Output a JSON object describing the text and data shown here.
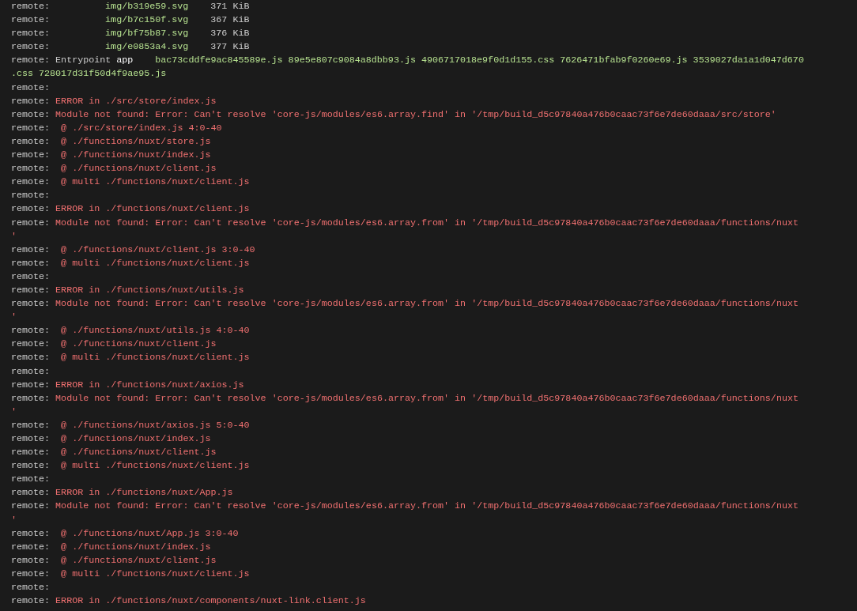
{
  "terminal": {
    "lines": [
      {
        "kind": "asset",
        "prefix": "remote:",
        "file": "img/b319e59.svg",
        "size": "371 KiB"
      },
      {
        "kind": "asset",
        "prefix": "remote:",
        "file": "img/b7c150f.svg",
        "size": "367 KiB"
      },
      {
        "kind": "asset",
        "prefix": "remote:",
        "file": "img/bf75b87.svg",
        "size": "376 KiB"
      },
      {
        "kind": "asset",
        "prefix": "remote:",
        "file": "img/e0853a4.svg",
        "size": "377 KiB"
      },
      {
        "kind": "entrypoint",
        "prefix": "remote:",
        "label": "Entrypoint",
        "name": "app",
        "files": "bac73cddfe9ac845589e.js 89e5e807c9084a8dbb93.js 4906717018e9f0d1d155.css 7626471bfab9f0260e69.js 3539027da1a1d047d670"
      },
      {
        "kind": "continuation_files",
        "text": ".css 728017d31f50d4f9ae95.js"
      },
      {
        "kind": "blank",
        "prefix": "remote:"
      },
      {
        "kind": "error",
        "prefix": "remote:",
        "text": "ERROR in ./src/store/index.js"
      },
      {
        "kind": "error",
        "prefix": "remote:",
        "text": "Module not found: Error: Can't resolve 'core-js/modules/es6.array.find' in '/tmp/build_d5c97840a476b0caac73f6e7de60daaa/src/store'"
      },
      {
        "kind": "error",
        "prefix": "remote:",
        "text": " @ ./src/store/index.js 4:0-40"
      },
      {
        "kind": "error",
        "prefix": "remote:",
        "text": " @ ./functions/nuxt/store.js"
      },
      {
        "kind": "error",
        "prefix": "remote:",
        "text": " @ ./functions/nuxt/index.js"
      },
      {
        "kind": "error",
        "prefix": "remote:",
        "text": " @ ./functions/nuxt/client.js"
      },
      {
        "kind": "error",
        "prefix": "remote:",
        "text": " @ multi ./functions/nuxt/client.js"
      },
      {
        "kind": "blank",
        "prefix": "remote:"
      },
      {
        "kind": "error",
        "prefix": "remote:",
        "text": "ERROR in ./functions/nuxt/client.js"
      },
      {
        "kind": "error",
        "prefix": "remote:",
        "text": "Module not found: Error: Can't resolve 'core-js/modules/es6.array.from' in '/tmp/build_d5c97840a476b0caac73f6e7de60daaa/functions/nuxt"
      },
      {
        "kind": "continuation_error",
        "text": "'"
      },
      {
        "kind": "error",
        "prefix": "remote:",
        "text": " @ ./functions/nuxt/client.js 3:0-40"
      },
      {
        "kind": "error",
        "prefix": "remote:",
        "text": " @ multi ./functions/nuxt/client.js"
      },
      {
        "kind": "blank",
        "prefix": "remote:"
      },
      {
        "kind": "error",
        "prefix": "remote:",
        "text": "ERROR in ./functions/nuxt/utils.js"
      },
      {
        "kind": "error",
        "prefix": "remote:",
        "text": "Module not found: Error: Can't resolve 'core-js/modules/es6.array.from' in '/tmp/build_d5c97840a476b0caac73f6e7de60daaa/functions/nuxt"
      },
      {
        "kind": "continuation_error",
        "text": "'"
      },
      {
        "kind": "error",
        "prefix": "remote:",
        "text": " @ ./functions/nuxt/utils.js 4:0-40"
      },
      {
        "kind": "error",
        "prefix": "remote:",
        "text": " @ ./functions/nuxt/client.js"
      },
      {
        "kind": "error",
        "prefix": "remote:",
        "text": " @ multi ./functions/nuxt/client.js"
      },
      {
        "kind": "blank",
        "prefix": "remote:"
      },
      {
        "kind": "error",
        "prefix": "remote:",
        "text": "ERROR in ./functions/nuxt/axios.js"
      },
      {
        "kind": "error",
        "prefix": "remote:",
        "text": "Module not found: Error: Can't resolve 'core-js/modules/es6.array.from' in '/tmp/build_d5c97840a476b0caac73f6e7de60daaa/functions/nuxt"
      },
      {
        "kind": "continuation_error",
        "text": "'"
      },
      {
        "kind": "error",
        "prefix": "remote:",
        "text": " @ ./functions/nuxt/axios.js 5:0-40"
      },
      {
        "kind": "error",
        "prefix": "remote:",
        "text": " @ ./functions/nuxt/index.js"
      },
      {
        "kind": "error",
        "prefix": "remote:",
        "text": " @ ./functions/nuxt/client.js"
      },
      {
        "kind": "error",
        "prefix": "remote:",
        "text": " @ multi ./functions/nuxt/client.js"
      },
      {
        "kind": "blank",
        "prefix": "remote:"
      },
      {
        "kind": "error",
        "prefix": "remote:",
        "text": "ERROR in ./functions/nuxt/App.js"
      },
      {
        "kind": "error",
        "prefix": "remote:",
        "text": "Module not found: Error: Can't resolve 'core-js/modules/es6.array.from' in '/tmp/build_d5c97840a476b0caac73f6e7de60daaa/functions/nuxt"
      },
      {
        "kind": "continuation_error",
        "text": "'"
      },
      {
        "kind": "error",
        "prefix": "remote:",
        "text": " @ ./functions/nuxt/App.js 3:0-40"
      },
      {
        "kind": "error",
        "prefix": "remote:",
        "text": " @ ./functions/nuxt/index.js"
      },
      {
        "kind": "error",
        "prefix": "remote:",
        "text": " @ ./functions/nuxt/client.js"
      },
      {
        "kind": "error",
        "prefix": "remote:",
        "text": " @ multi ./functions/nuxt/client.js"
      },
      {
        "kind": "blank",
        "prefix": "remote:"
      },
      {
        "kind": "error",
        "prefix": "remote:",
        "text": "ERROR in ./functions/nuxt/components/nuxt-link.client.js"
      }
    ]
  }
}
